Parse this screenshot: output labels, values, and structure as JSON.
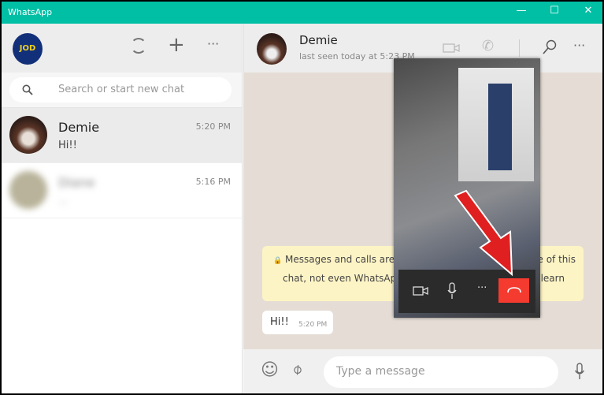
{
  "window": {
    "title": "WhatsApp",
    "minimize": "—",
    "maximize": "☐",
    "close": "✕"
  },
  "sidebar": {
    "profile_initials": "JOD",
    "icons": [
      "status-icon",
      "new-chat-icon",
      "menu-icon"
    ],
    "menu_label": "···",
    "new_chat_label": "+",
    "search": {
      "placeholder": "Search or start new chat"
    },
    "chats": [
      {
        "name": "Demie",
        "message": "Hi!!",
        "time": "5:20 PM",
        "selected": true
      },
      {
        "name": "Diane",
        "message": "...",
        "time": "5:16 PM",
        "blurred": true
      }
    ]
  },
  "conversation": {
    "name": "Demie",
    "status": "last seen today at 5:23 PM",
    "menu_label": "···",
    "encryption_notice": "Messages and calls are end-to-end encrypted. No one outside of this chat, not even WhatsApp, can read or listen to them. Click to learn more.",
    "notice_visible_left": "Messages and calls are enc",
    "notice_visible_right": "e of this",
    "notice_line2_left": "chat, not even WhatsApp, ",
    "notice_line2_right": "learn",
    "messages": [
      {
        "text": "Hi!!",
        "time": "5:20 PM",
        "direction": "incoming"
      }
    ],
    "input": {
      "placeholder": "Type a message"
    }
  },
  "call_overlay": {
    "more_label": "···",
    "end_call_color": "#f53a2f",
    "annotation": "red-arrow-pointing-to-end-call"
  },
  "colors": {
    "accent": "#00bfa5",
    "chat_bg": "#e5ddd5",
    "notice_bg": "#fdf4c5"
  }
}
